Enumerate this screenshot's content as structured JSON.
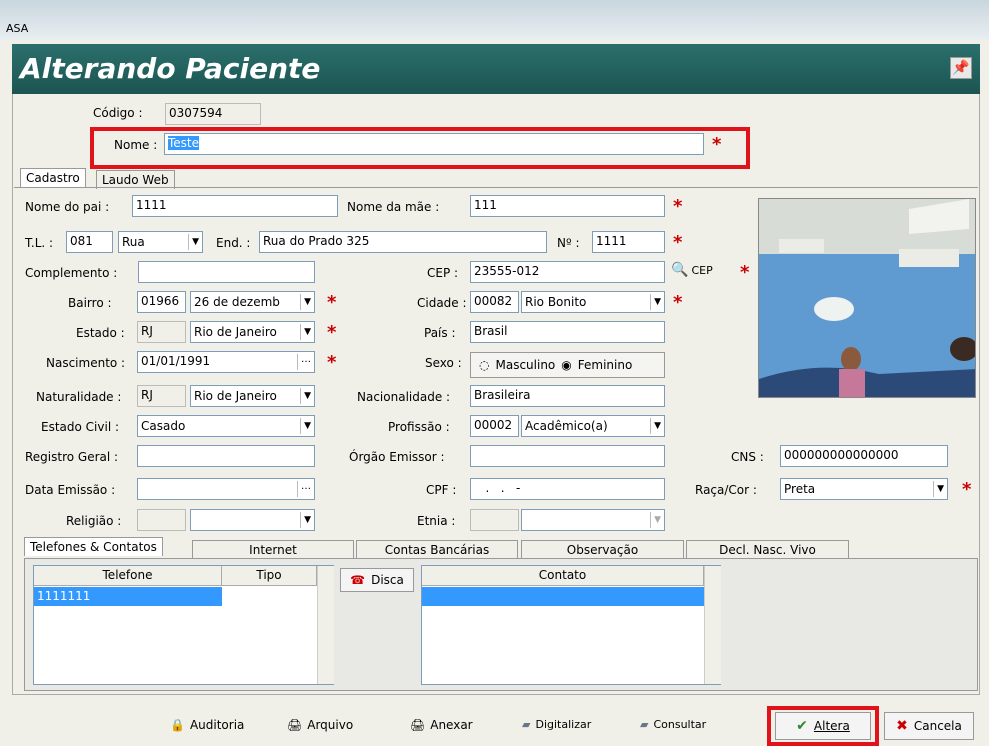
{
  "window": {
    "title": "ASA"
  },
  "header": {
    "title": "Alterando Paciente"
  },
  "codigo": {
    "label": "Código :",
    "value": "0307594"
  },
  "nome": {
    "label": "Nome :",
    "value": "Teste"
  },
  "tabs_top": [
    {
      "label": "Cadastro"
    },
    {
      "label": "Laudo Web"
    }
  ],
  "fields": {
    "nome_pai": {
      "label": "Nome do pai :",
      "value": "1111"
    },
    "nome_mae": {
      "label": "Nome da mãe :",
      "value": "111"
    },
    "tl": {
      "label": "T.L. :",
      "code": "081",
      "type": "Rua"
    },
    "end": {
      "label": "End. :",
      "value": "Rua do Prado 325"
    },
    "numero": {
      "label": "Nº :",
      "value": "1111"
    },
    "complemento": {
      "label": "Complemento :",
      "value": ""
    },
    "cep": {
      "label": "CEP :",
      "value": "23555-012",
      "btn": "CEP"
    },
    "bairro": {
      "label": "Bairro :",
      "code": "01966",
      "value": "26 de dezemb"
    },
    "cidade": {
      "label": "Cidade :",
      "code": "00082",
      "value": "Rio Bonito"
    },
    "estado": {
      "label": "Estado :",
      "code": "RJ",
      "value": "Rio de Janeiro"
    },
    "pais": {
      "label": "País :",
      "value": "Brasil"
    },
    "nascimento": {
      "label": "Nascimento :",
      "value": "01/01/1991"
    },
    "sexo": {
      "label": "Sexo :",
      "opt1": "Masculino",
      "opt2": "Feminino"
    },
    "naturalidade": {
      "label": "Naturalidade :",
      "code": "RJ",
      "value": "Rio de Janeiro"
    },
    "nacionalidade": {
      "label": "Nacionalidade :",
      "value": "Brasileira"
    },
    "estado_civil": {
      "label": "Estado Civil :",
      "value": "Casado"
    },
    "profissao": {
      "label": "Profissão :",
      "code": "00002",
      "value": "Acadêmico(a)"
    },
    "registro_geral": {
      "label": "Registro Geral :",
      "value": ""
    },
    "orgao_emissor": {
      "label": "Órgão Emissor :",
      "value": ""
    },
    "cns": {
      "label": "CNS :",
      "value": "000000000000000"
    },
    "data_emissao": {
      "label": "Data Emissão :",
      "value": ""
    },
    "cpf": {
      "label": "CPF :",
      "value": "   .   .   -"
    },
    "raca_cor": {
      "label": "Raça/Cor :",
      "value": "Preta"
    },
    "religiao": {
      "label": "Religião :",
      "value": ""
    },
    "etnia": {
      "label": "Etnia :",
      "value": ""
    }
  },
  "tabs_bottom": [
    {
      "label": "Telefones & Contatos"
    },
    {
      "label": "Internet"
    },
    {
      "label": "Contas Bancárias"
    },
    {
      "label": "Observação"
    },
    {
      "label": "Decl. Nasc. Vivo"
    }
  ],
  "phone_table": {
    "headers": [
      "Telefone",
      "Tipo"
    ],
    "rows": [
      [
        "1111111",
        ""
      ]
    ]
  },
  "disca_label": "Disca",
  "contact_table": {
    "header": "Contato"
  },
  "toolbar": {
    "auditoria": "Auditoria",
    "arquivo": "Arquivo",
    "anexar": "Anexar",
    "digitalizar": "Digitalizar",
    "consultar": "Consultar",
    "altera": "Altera",
    "cancela": "Cancela"
  },
  "colors": {
    "header_bg": "#1f5f5c",
    "highlight": "#e0131a",
    "selection": "#3399ff",
    "required": "#cc0000"
  },
  "icons": [
    "pin-icon",
    "cep-search-icon",
    "phone-icon",
    "padlock-icon",
    "printer-icon",
    "scanner-icon",
    "check-icon",
    "x-icon"
  ]
}
